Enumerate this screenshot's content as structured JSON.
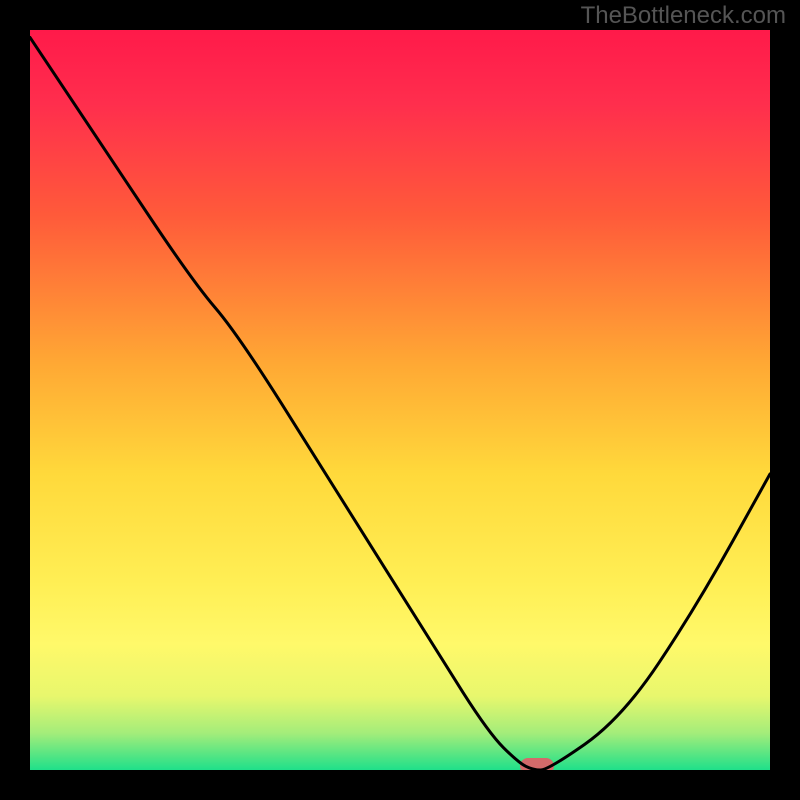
{
  "watermark": "TheBottleneck.com",
  "chart_data": {
    "type": "line",
    "title": "",
    "xlabel": "",
    "ylabel": "",
    "xlim": [
      0,
      100
    ],
    "ylim": [
      0,
      100
    ],
    "series": [
      {
        "name": "curve",
        "x": [
          0,
          10,
          22,
          28,
          40,
          55,
          62,
          66,
          68,
          70,
          80,
          90,
          100
        ],
        "values": [
          99,
          84,
          66,
          59,
          40,
          16,
          5,
          1,
          0,
          0,
          7,
          22,
          40
        ]
      }
    ],
    "marker": {
      "x": 68.5,
      "y": 0.5
    },
    "background": {
      "type": "vertical-gradient",
      "stops": [
        {
          "pos": 0,
          "color": "#ff1a4a"
        },
        {
          "pos": 25,
          "color": "#ff5a3a"
        },
        {
          "pos": 50,
          "color": "#ffc23a"
        },
        {
          "pos": 75,
          "color": "#ffef55"
        },
        {
          "pos": 95,
          "color": "#a4ed7a"
        },
        {
          "pos": 100,
          "color": "#1fe08a"
        }
      ]
    }
  }
}
